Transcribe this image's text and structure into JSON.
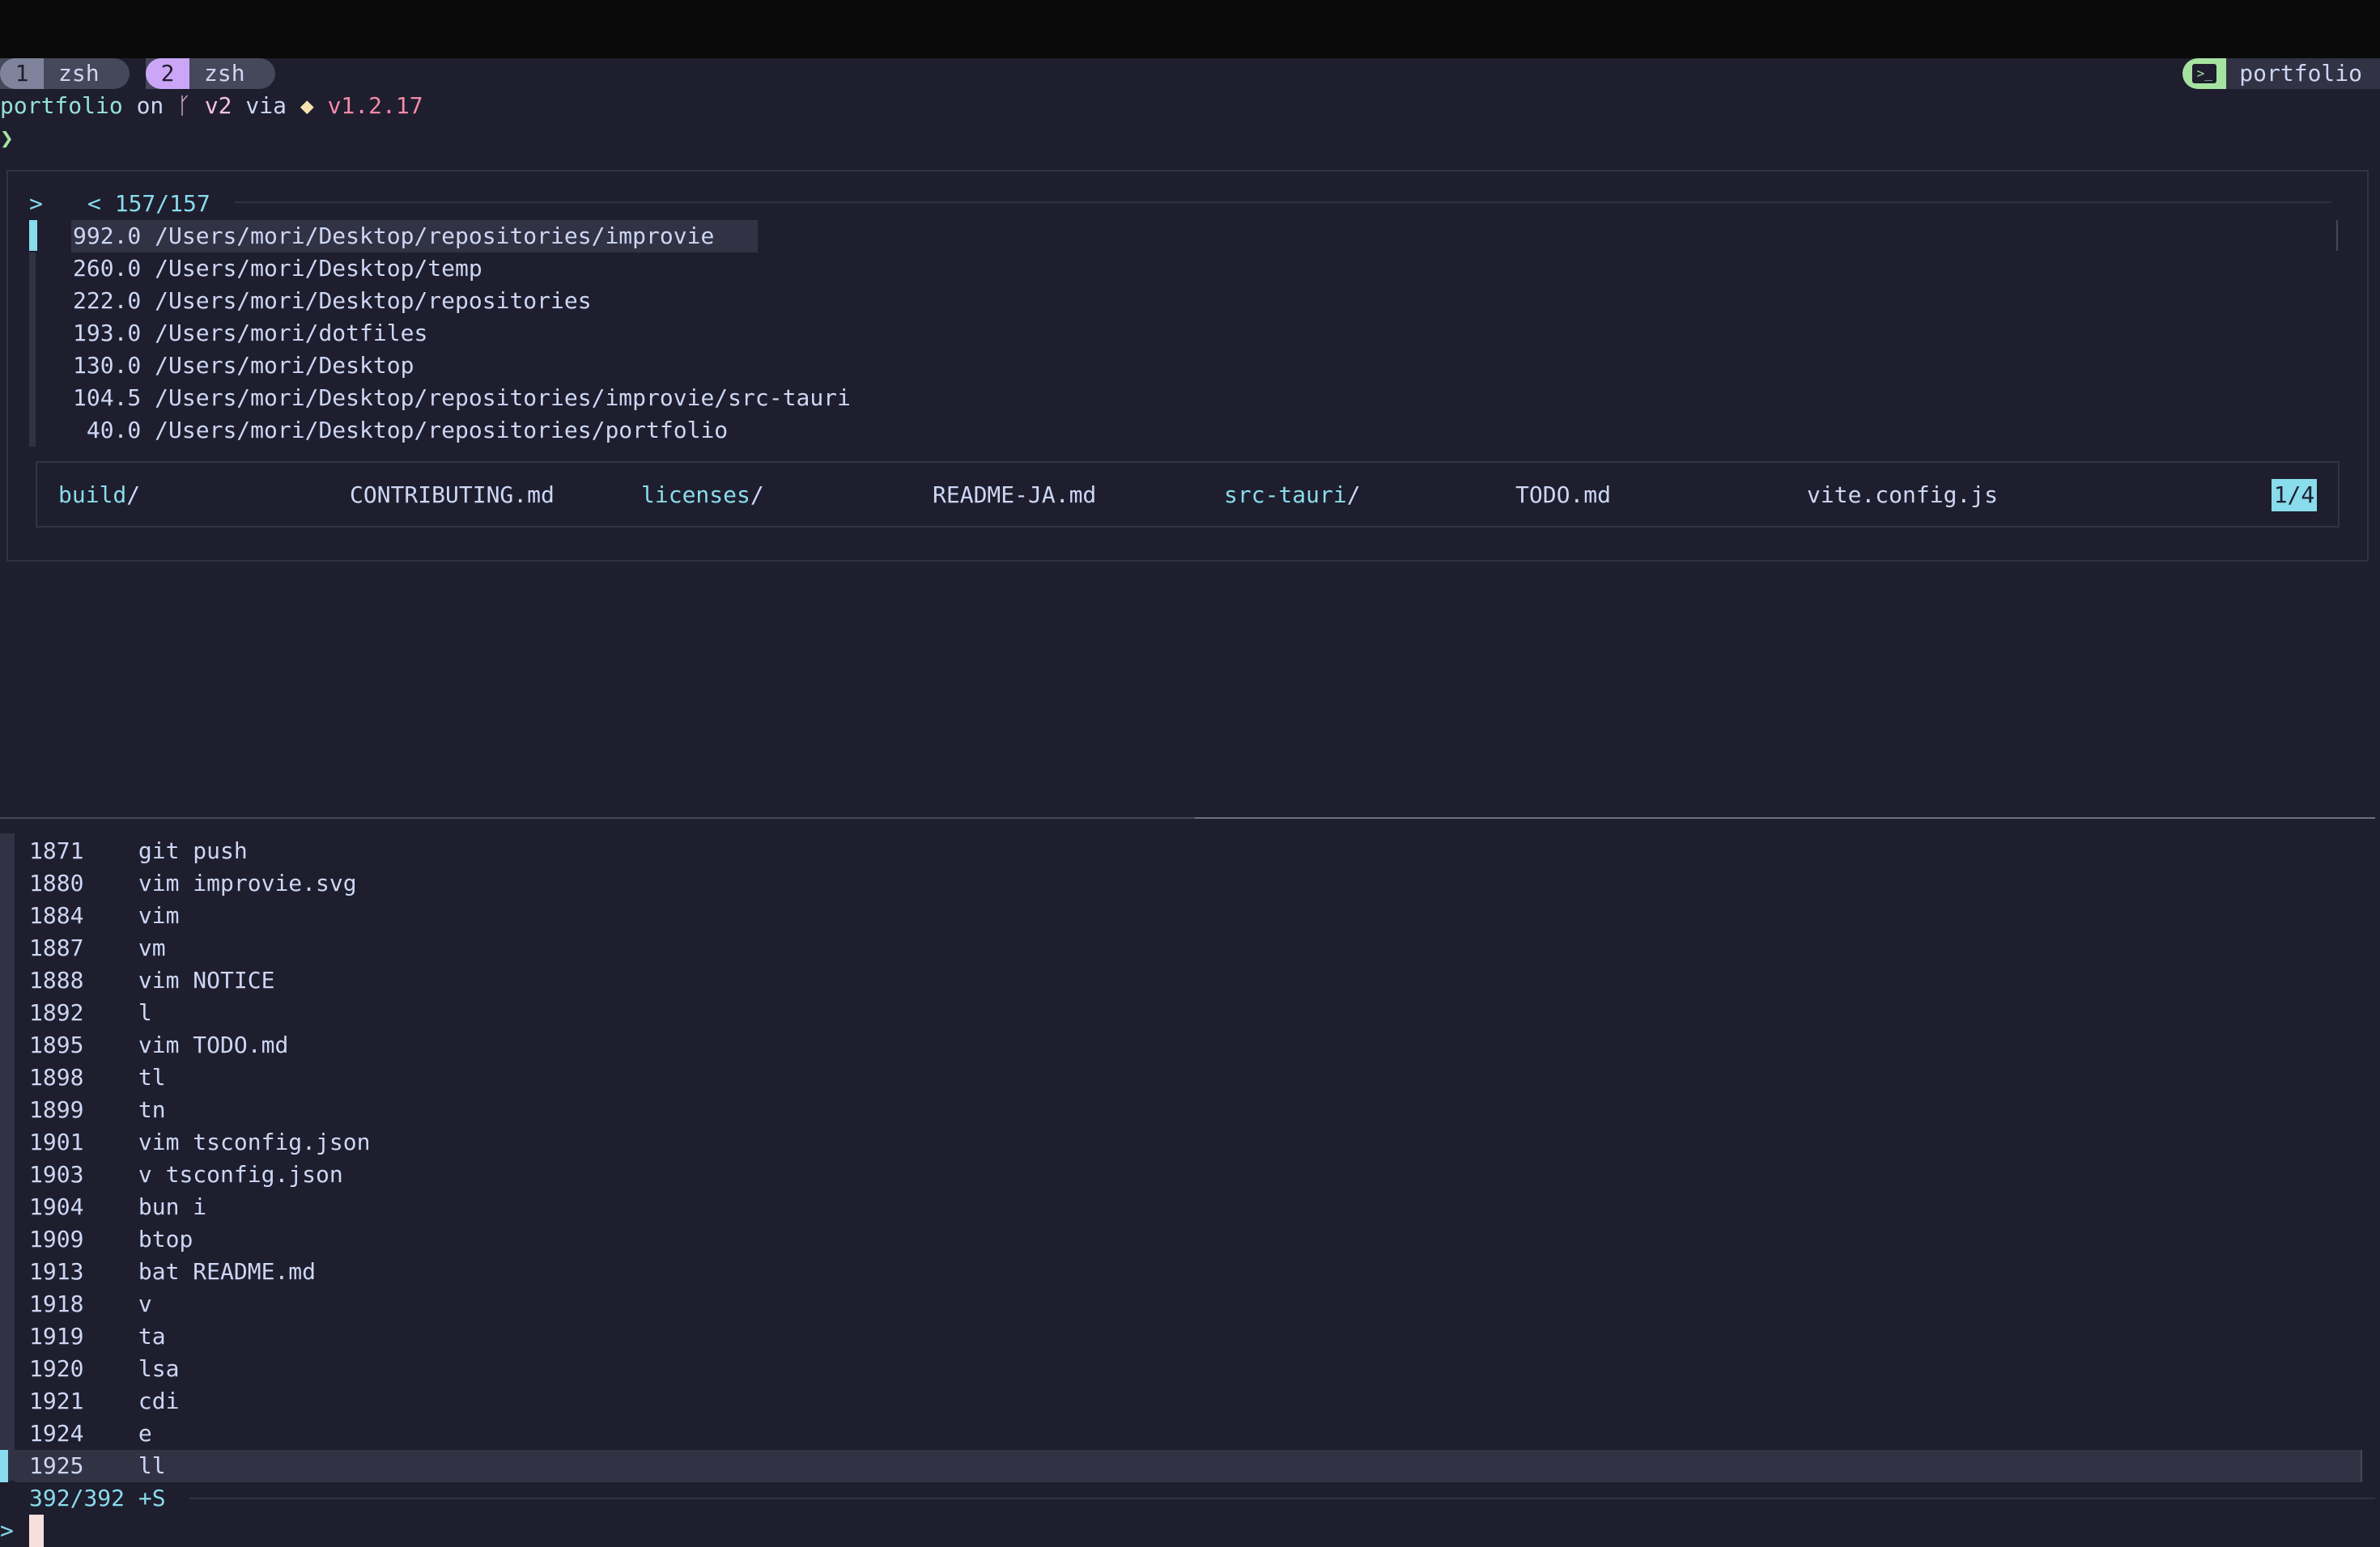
{
  "tabs": [
    {
      "num": "1",
      "name": "zsh"
    },
    {
      "num": "2",
      "name": "zsh"
    }
  ],
  "session": {
    "icon": "terminal-icon",
    "name": "portfolio"
  },
  "prompt": {
    "dir": "portfolio",
    "on": "on",
    "branch_icon": "git-branch-icon",
    "branch": "v2",
    "via": "via",
    "runtime_icon": "bun-icon",
    "version": "v1.2.17",
    "symbol": "❯"
  },
  "zoxide": {
    "prompt_symbol": ">",
    "count": "< 157/157",
    "entries": [
      {
        "score": "992.0",
        "path": "/Users/mori/Desktop/repositories/improvie"
      },
      {
        "score": "260.0",
        "path": "/Users/mori/Desktop/temp"
      },
      {
        "score": "222.0",
        "path": "/Users/mori/Desktop/repositories"
      },
      {
        "score": "193.0",
        "path": "/Users/mori/dotfiles"
      },
      {
        "score": "130.0",
        "path": "/Users/mori/Desktop"
      },
      {
        "score": "104.5",
        "path": "/Users/mori/Desktop/repositories/improvie/src-tauri"
      },
      {
        "score": " 40.0",
        "path": "/Users/mori/Desktop/repositories/portfolio"
      }
    ],
    "preview": {
      "items": [
        {
          "name": "build",
          "suffix": "/",
          "dir": true
        },
        {
          "name": "CONTRIBUTING.md",
          "suffix": "",
          "dir": false
        },
        {
          "name": "licenses",
          "suffix": "/",
          "dir": true
        },
        {
          "name": "README-JA.md",
          "suffix": "",
          "dir": false
        },
        {
          "name": "src-tauri",
          "suffix": "/",
          "dir": true
        },
        {
          "name": "TODO.md",
          "suffix": "",
          "dir": false
        },
        {
          "name": "vite.config.js",
          "suffix": "",
          "dir": false
        }
      ],
      "page": "1/4"
    }
  },
  "history": {
    "entries": [
      {
        "num": "1871",
        "cmd": "git push"
      },
      {
        "num": "1880",
        "cmd": "vim improvie.svg"
      },
      {
        "num": "1884",
        "cmd": "vim"
      },
      {
        "num": "1887",
        "cmd": "vm"
      },
      {
        "num": "1888",
        "cmd": "vim NOTICE"
      },
      {
        "num": "1892",
        "cmd": "l"
      },
      {
        "num": "1895",
        "cmd": "vim TODO.md"
      },
      {
        "num": "1898",
        "cmd": "tl"
      },
      {
        "num": "1899",
        "cmd": "tn"
      },
      {
        "num": "1901",
        "cmd": "vim tsconfig.json"
      },
      {
        "num": "1903",
        "cmd": "v tsconfig.json"
      },
      {
        "num": "1904",
        "cmd": "bun i"
      },
      {
        "num": "1909",
        "cmd": "btop"
      },
      {
        "num": "1913",
        "cmd": "bat README.md"
      },
      {
        "num": "1918",
        "cmd": "v"
      },
      {
        "num": "1919",
        "cmd": "ta"
      },
      {
        "num": "1920",
        "cmd": "lsa"
      },
      {
        "num": "1921",
        "cmd": "cdi"
      },
      {
        "num": "1924",
        "cmd": "e"
      },
      {
        "num": "1925",
        "cmd": "ll"
      }
    ],
    "count": "392/392 +S",
    "prompt_symbol": ">"
  },
  "colors": {
    "background": "#1e1e2e",
    "accent": "#89dceb",
    "prompt_dir": "#94e2d5",
    "branch": "#f5c2e7",
    "version": "#f38ba8"
  }
}
